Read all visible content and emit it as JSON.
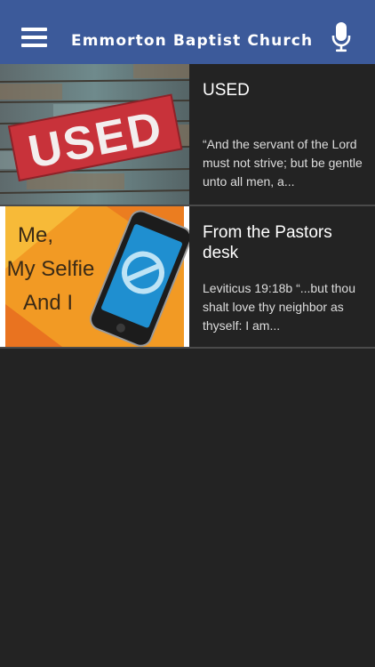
{
  "header": {
    "title": "Emmorton Baptist Church",
    "menu_icon": "hamburger-menu-icon",
    "mic_icon": "microphone-icon"
  },
  "posts": [
    {
      "title": "USED",
      "description": "“And the servant of the Lord must not strive; but be gentle unto all men, a...",
      "image_text": "USED"
    },
    {
      "title": "From the Pastors desk",
      "description": "Leviticus 19:18b “...but thou shalt love thy neighbor as thyself: I am...",
      "image_lines": [
        "Me,",
        "My Selfie",
        "And I"
      ]
    }
  ],
  "colors": {
    "header_bg": "#3c5a9a",
    "list_bg": "#232323",
    "divider": "#4a4a4a"
  }
}
